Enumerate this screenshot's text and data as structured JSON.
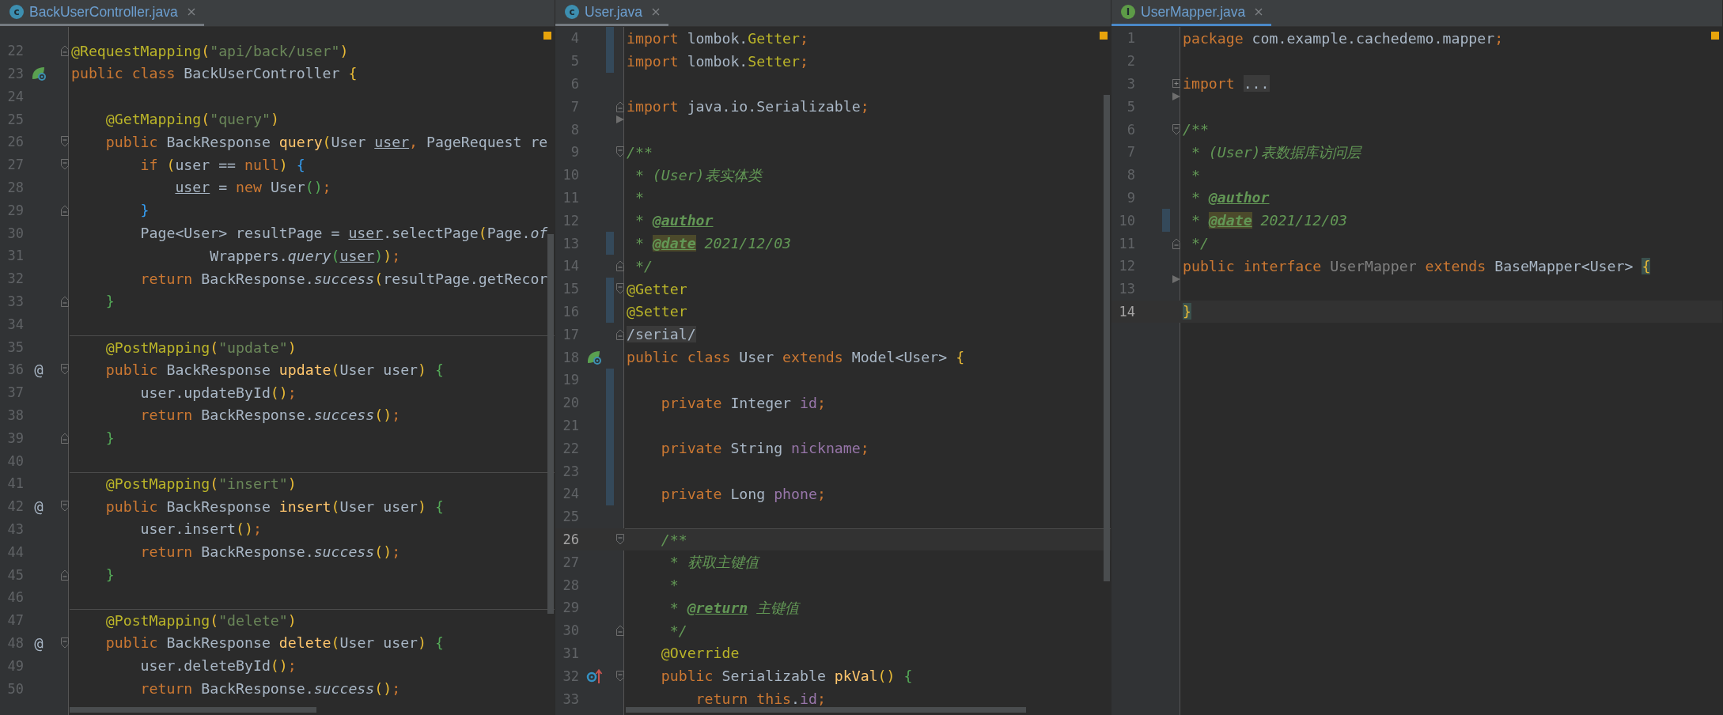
{
  "panes": [
    {
      "tab": {
        "icon": {
          "kind": "class",
          "letter": "c"
        },
        "label": "BackUserController.java",
        "selected": false
      },
      "lines": [
        {
          "number": "22",
          "current": false,
          "changed": false,
          "fold": {
            "kind": "close"
          },
          "tokens": [
            {
              "kind": "annotation",
              "text": "@RequestMapping"
            },
            {
              "kind": "paren_y",
              "text": "("
            },
            {
              "kind": "string",
              "text": "\"api/back/user\""
            },
            {
              "kind": "paren_y",
              "text": ")"
            }
          ]
        },
        {
          "number": "23",
          "current": false,
          "changed": false,
          "gutter_icon": {
            "kind": "bean"
          },
          "tokens": [
            {
              "kind": "keyword",
              "text": "public class "
            },
            {
              "kind": "plain",
              "text": "BackUserController "
            },
            {
              "kind": "paren_y",
              "text": "{"
            }
          ]
        },
        {
          "number": "24",
          "current": false,
          "changed": false
        },
        {
          "number": "25",
          "current": false,
          "changed": false,
          "tokens": [
            {
              "kind": "annotation",
              "text": "    @GetMapping"
            },
            {
              "kind": "paren_y",
              "text": "("
            },
            {
              "kind": "string",
              "text": "\"query\""
            },
            {
              "kind": "paren_y",
              "text": ")"
            }
          ]
        },
        {
          "number": "26",
          "current": false,
          "changed": false,
          "fold": {
            "kind": "open"
          },
          "tokens": [
            {
              "kind": "keyword",
              "text": "    public "
            },
            {
              "kind": "plain",
              "text": "BackResponse "
            },
            {
              "kind": "declaration",
              "text": "query"
            },
            {
              "kind": "paren_y",
              "text": "("
            },
            {
              "kind": "plain",
              "text": "User "
            },
            {
              "kind": "ref",
              "text": "user"
            },
            {
              "kind": "keyword",
              "text": ", "
            },
            {
              "kind": "plain",
              "text": "PageRequest re"
            }
          ]
        },
        {
          "number": "27",
          "current": false,
          "changed": false,
          "fold": {
            "kind": "open"
          },
          "tokens": [
            {
              "kind": "keyword",
              "text": "        if "
            },
            {
              "kind": "paren_y",
              "text": "("
            },
            {
              "kind": "plain",
              "text": "user == "
            },
            {
              "kind": "keyword",
              "text": "null"
            },
            {
              "kind": "paren_y",
              "text": ")"
            },
            {
              "kind": "paren_b",
              "text": " {"
            }
          ]
        },
        {
          "number": "28",
          "current": false,
          "changed": false,
          "tokens": [
            {
              "kind": "ref",
              "text": "            user"
            },
            {
              "kind": "plain",
              "text": " = "
            },
            {
              "kind": "keyword",
              "text": "new "
            },
            {
              "kind": "plain",
              "text": "User"
            },
            {
              "kind": "paren_g",
              "text": "()"
            },
            {
              "kind": "keyword",
              "text": ";"
            }
          ]
        },
        {
          "number": "29",
          "current": false,
          "changed": false,
          "fold": {
            "kind": "close"
          },
          "tokens": [
            {
              "kind": "paren_b",
              "text": "        }"
            }
          ]
        },
        {
          "number": "30",
          "current": false,
          "changed": false,
          "tokens": [
            {
              "kind": "plain",
              "text": "        Page<User> resultPage = "
            },
            {
              "kind": "ref",
              "text": "user"
            },
            {
              "kind": "plain",
              "text": ".selectPage"
            },
            {
              "kind": "paren_y",
              "text": "("
            },
            {
              "kind": "plain",
              "text": "Page."
            },
            {
              "kind": "static",
              "text": "of"
            }
          ]
        },
        {
          "number": "31",
          "current": false,
          "changed": false,
          "tokens": [
            {
              "kind": "plain",
              "text": "                Wrappers."
            },
            {
              "kind": "static",
              "text": "query"
            },
            {
              "kind": "paren_g",
              "text": "("
            },
            {
              "kind": "ref",
              "text": "user"
            },
            {
              "kind": "paren_g",
              "text": ")"
            },
            {
              "kind": "paren_y",
              "text": ")"
            },
            {
              "kind": "keyword",
              "text": ";"
            }
          ]
        },
        {
          "number": "32",
          "current": false,
          "changed": false,
          "tokens": [
            {
              "kind": "keyword",
              "text": "        return "
            },
            {
              "kind": "plain",
              "text": "BackResponse."
            },
            {
              "kind": "static",
              "text": "success"
            },
            {
              "kind": "paren_y",
              "text": "("
            },
            {
              "kind": "plain",
              "text": "resultPage.getRecor"
            }
          ]
        },
        {
          "number": "33",
          "current": false,
          "changed": false,
          "fold": {
            "kind": "close"
          },
          "tokens": [
            {
              "kind": "paren_g",
              "text": "    }"
            }
          ]
        },
        {
          "number": "34",
          "current": false,
          "changed": false
        },
        {
          "number": "35",
          "current": false,
          "changed": false,
          "separator": true,
          "tokens": [
            {
              "kind": "annotation",
              "text": "    @PostMapping"
            },
            {
              "kind": "paren_y",
              "text": "("
            },
            {
              "kind": "string",
              "text": "\"update\""
            },
            {
              "kind": "paren_y",
              "text": ")"
            }
          ]
        },
        {
          "number": "36",
          "current": false,
          "changed": false,
          "marker": "@",
          "fold": {
            "kind": "open"
          },
          "tokens": [
            {
              "kind": "keyword",
              "text": "    public "
            },
            {
              "kind": "plain",
              "text": "BackResponse "
            },
            {
              "kind": "declaration",
              "text": "update"
            },
            {
              "kind": "paren_y",
              "text": "("
            },
            {
              "kind": "plain",
              "text": "User user"
            },
            {
              "kind": "paren_y",
              "text": ")"
            },
            {
              "kind": "paren_g",
              "text": " {"
            }
          ]
        },
        {
          "number": "37",
          "current": false,
          "changed": false,
          "tokens": [
            {
              "kind": "plain",
              "text": "        user.updateById"
            },
            {
              "kind": "paren_y",
              "text": "()"
            },
            {
              "kind": "keyword",
              "text": ";"
            }
          ]
        },
        {
          "number": "38",
          "current": false,
          "changed": false,
          "tokens": [
            {
              "kind": "keyword",
              "text": "        return "
            },
            {
              "kind": "plain",
              "text": "BackResponse."
            },
            {
              "kind": "static",
              "text": "success"
            },
            {
              "kind": "paren_y",
              "text": "()"
            },
            {
              "kind": "keyword",
              "text": ";"
            }
          ]
        },
        {
          "number": "39",
          "current": false,
          "changed": false,
          "fold": {
            "kind": "close"
          },
          "tokens": [
            {
              "kind": "paren_g",
              "text": "    }"
            }
          ]
        },
        {
          "number": "40",
          "current": false,
          "changed": false
        },
        {
          "number": "41",
          "current": false,
          "changed": false,
          "separator": true,
          "tokens": [
            {
              "kind": "annotation",
              "text": "    @PostMapping"
            },
            {
              "kind": "paren_y",
              "text": "("
            },
            {
              "kind": "string",
              "text": "\"insert\""
            },
            {
              "kind": "paren_y",
              "text": ")"
            }
          ]
        },
        {
          "number": "42",
          "current": false,
          "changed": false,
          "marker": "@",
          "fold": {
            "kind": "open"
          },
          "tokens": [
            {
              "kind": "keyword",
              "text": "    public "
            },
            {
              "kind": "plain",
              "text": "BackResponse "
            },
            {
              "kind": "declaration",
              "text": "insert"
            },
            {
              "kind": "paren_y",
              "text": "("
            },
            {
              "kind": "plain",
              "text": "User user"
            },
            {
              "kind": "paren_y",
              "text": ")"
            },
            {
              "kind": "paren_g",
              "text": " {"
            }
          ]
        },
        {
          "number": "43",
          "current": false,
          "changed": false,
          "tokens": [
            {
              "kind": "plain",
              "text": "        user.insert"
            },
            {
              "kind": "paren_y",
              "text": "()"
            },
            {
              "kind": "keyword",
              "text": ";"
            }
          ]
        },
        {
          "number": "44",
          "current": false,
          "changed": false,
          "tokens": [
            {
              "kind": "keyword",
              "text": "        return "
            },
            {
              "kind": "plain",
              "text": "BackResponse."
            },
            {
              "kind": "static",
              "text": "success"
            },
            {
              "kind": "paren_y",
              "text": "()"
            },
            {
              "kind": "keyword",
              "text": ";"
            }
          ]
        },
        {
          "number": "45",
          "current": false,
          "changed": false,
          "fold": {
            "kind": "close"
          },
          "tokens": [
            {
              "kind": "paren_g",
              "text": "    }"
            }
          ]
        },
        {
          "number": "46",
          "current": false,
          "changed": false
        },
        {
          "number": "47",
          "current": false,
          "changed": false,
          "separator": true,
          "tokens": [
            {
              "kind": "annotation",
              "text": "    @PostMapping"
            },
            {
              "kind": "paren_y",
              "text": "("
            },
            {
              "kind": "string",
              "text": "\"delete\""
            },
            {
              "kind": "paren_y",
              "text": ")"
            }
          ]
        },
        {
          "number": "48",
          "current": false,
          "changed": false,
          "marker": "@",
          "fold": {
            "kind": "open"
          },
          "tokens": [
            {
              "kind": "keyword",
              "text": "    public "
            },
            {
              "kind": "plain",
              "text": "BackResponse "
            },
            {
              "kind": "declaration",
              "text": "delete"
            },
            {
              "kind": "paren_y",
              "text": "("
            },
            {
              "kind": "plain",
              "text": "User user"
            },
            {
              "kind": "paren_y",
              "text": ")"
            },
            {
              "kind": "paren_g",
              "text": " {"
            }
          ]
        },
        {
          "number": "49",
          "current": false,
          "changed": false,
          "tokens": [
            {
              "kind": "plain",
              "text": "        user.deleteById"
            },
            {
              "kind": "paren_y",
              "text": "()"
            },
            {
              "kind": "keyword",
              "text": ";"
            }
          ]
        },
        {
          "number": "50",
          "current": false,
          "changed": false,
          "tokens": [
            {
              "kind": "keyword",
              "text": "        return "
            },
            {
              "kind": "plain",
              "text": "BackResponse."
            },
            {
              "kind": "static",
              "text": "success"
            },
            {
              "kind": "paren_y",
              "text": "()"
            },
            {
              "kind": "keyword",
              "text": ";"
            }
          ]
        }
      ]
    },
    {
      "tab": {
        "icon": {
          "kind": "class",
          "letter": "c"
        },
        "label": "User.java",
        "selected": false
      },
      "lines": [
        {
          "number": "4",
          "current": false,
          "changed": true,
          "tokens": [
            {
              "kind": "keyword",
              "text": "import "
            },
            {
              "kind": "plain",
              "text": "lombok."
            },
            {
              "kind": "annotation",
              "text": "Getter"
            },
            {
              "kind": "keyword",
              "text": ";"
            }
          ]
        },
        {
          "number": "5",
          "current": false,
          "changed": true,
          "tokens": [
            {
              "kind": "keyword",
              "text": "import "
            },
            {
              "kind": "plain",
              "text": "lombok."
            },
            {
              "kind": "annotation",
              "text": "Setter"
            },
            {
              "kind": "keyword",
              "text": ";"
            }
          ]
        },
        {
          "number": "6",
          "current": false,
          "changed": false
        },
        {
          "number": "7",
          "current": false,
          "changed": false,
          "fold": {
            "kind": "close"
          },
          "tokens": [
            {
              "kind": "keyword",
              "text": "import "
            },
            {
              "kind": "plain",
              "text": "java.io.Serializable"
            },
            {
              "kind": "keyword",
              "text": ";"
            }
          ]
        },
        {
          "number": "8",
          "current": false,
          "changed": false,
          "fold": {
            "kind": "arrow"
          }
        },
        {
          "number": "9",
          "current": false,
          "changed": false,
          "fold": {
            "kind": "open"
          },
          "tokens": [
            {
              "kind": "doc",
              "text": "/**"
            }
          ]
        },
        {
          "number": "10",
          "current": false,
          "changed": false,
          "tokens": [
            {
              "kind": "doc",
              "text": " * (User)表实体类"
            }
          ]
        },
        {
          "number": "11",
          "current": false,
          "changed": false,
          "tokens": [
            {
              "kind": "doc",
              "text": " *"
            }
          ]
        },
        {
          "number": "12",
          "current": false,
          "changed": false,
          "tokens": [
            {
              "kind": "doc",
              "text": " * "
            },
            {
              "kind": "doctag",
              "text": "@author"
            }
          ]
        },
        {
          "number": "13",
          "current": false,
          "changed": true,
          "tokens": [
            {
              "kind": "doc",
              "text": " * "
            },
            {
              "kind": "doctag_box",
              "text": "@date"
            },
            {
              "kind": "doc",
              "text": " 2021/12/03"
            }
          ]
        },
        {
          "number": "14",
          "current": false,
          "changed": false,
          "fold": {
            "kind": "close"
          },
          "tokens": [
            {
              "kind": "doc",
              "text": " */"
            }
          ]
        },
        {
          "number": "15",
          "current": false,
          "changed": true,
          "fold": {
            "kind": "open"
          },
          "tokens": [
            {
              "kind": "annotation",
              "text": "@Getter"
            }
          ]
        },
        {
          "number": "16",
          "current": false,
          "changed": true,
          "tokens": [
            {
              "kind": "annotation",
              "text": "@Setter"
            }
          ]
        },
        {
          "number": "17",
          "current": false,
          "changed": false,
          "fold": {
            "kind": "close"
          },
          "tokens": [
            {
              "kind": "folded",
              "text": "/serial/"
            }
          ]
        },
        {
          "number": "18",
          "current": false,
          "changed": false,
          "gutter_icon": {
            "kind": "bean"
          },
          "tokens": [
            {
              "kind": "keyword",
              "text": "public class "
            },
            {
              "kind": "plain",
              "text": "User "
            },
            {
              "kind": "keyword",
              "text": "extends "
            },
            {
              "kind": "plain",
              "text": "Model<User> "
            },
            {
              "kind": "paren_y",
              "text": "{"
            }
          ]
        },
        {
          "number": "19",
          "current": false,
          "changed": true
        },
        {
          "number": "20",
          "current": false,
          "changed": true,
          "tokens": [
            {
              "kind": "keyword",
              "text": "    private "
            },
            {
              "kind": "plain",
              "text": "Integer "
            },
            {
              "kind": "field",
              "text": "id"
            },
            {
              "kind": "keyword",
              "text": ";"
            }
          ]
        },
        {
          "number": "21",
          "current": false,
          "changed": true
        },
        {
          "number": "22",
          "current": false,
          "changed": true,
          "tokens": [
            {
              "kind": "keyword",
              "text": "    private "
            },
            {
              "kind": "plain",
              "text": "String "
            },
            {
              "kind": "field",
              "text": "nickname"
            },
            {
              "kind": "keyword",
              "text": ";"
            }
          ]
        },
        {
          "number": "23",
          "current": false,
          "changed": true
        },
        {
          "number": "24",
          "current": false,
          "changed": true,
          "tokens": [
            {
              "kind": "keyword",
              "text": "    private "
            },
            {
              "kind": "plain",
              "text": "Long "
            },
            {
              "kind": "field",
              "text": "phone"
            },
            {
              "kind": "keyword",
              "text": ";"
            }
          ]
        },
        {
          "number": "25",
          "current": false,
          "changed": false
        },
        {
          "number": "26",
          "current": true,
          "changed": false,
          "separator": true,
          "fold": {
            "kind": "open"
          },
          "tokens": [
            {
              "kind": "doc",
              "text": "    /**"
            }
          ]
        },
        {
          "number": "27",
          "current": false,
          "changed": false,
          "tokens": [
            {
              "kind": "doc",
              "text": "     * 获取主键值"
            }
          ]
        },
        {
          "number": "28",
          "current": false,
          "changed": false,
          "tokens": [
            {
              "kind": "doc",
              "text": "     *"
            }
          ]
        },
        {
          "number": "29",
          "current": false,
          "changed": false,
          "tokens": [
            {
              "kind": "doc",
              "text": "     * "
            },
            {
              "kind": "doctag",
              "text": "@return"
            },
            {
              "kind": "doc",
              "text": " 主键值"
            }
          ]
        },
        {
          "number": "30",
          "current": false,
          "changed": false,
          "fold": {
            "kind": "close"
          },
          "tokens": [
            {
              "kind": "doc",
              "text": "     */"
            }
          ]
        },
        {
          "number": "31",
          "current": false,
          "changed": false,
          "tokens": [
            {
              "kind": "annotation",
              "text": "    @Override"
            }
          ]
        },
        {
          "number": "32",
          "current": false,
          "changed": false,
          "gutter_icon": {
            "kind": "override"
          },
          "fold": {
            "kind": "open"
          },
          "tokens": [
            {
              "kind": "keyword",
              "text": "    public "
            },
            {
              "kind": "plain",
              "text": "Serializable "
            },
            {
              "kind": "declaration",
              "text": "pkVal"
            },
            {
              "kind": "paren_y",
              "text": "()"
            },
            {
              "kind": "paren_g",
              "text": " {"
            }
          ]
        },
        {
          "number": "33",
          "current": false,
          "changed": false,
          "tokens": [
            {
              "kind": "keyword",
              "text": "        return this"
            },
            {
              "kind": "plain",
              "text": "."
            },
            {
              "kind": "field",
              "text": "id"
            },
            {
              "kind": "keyword",
              "text": ";"
            }
          ]
        }
      ]
    },
    {
      "tab": {
        "icon": {
          "kind": "interface",
          "letter": "I"
        },
        "label": "UserMapper.java",
        "selected": true
      },
      "lines": [
        {
          "number": "1",
          "current": false,
          "changed": false,
          "tokens": [
            {
              "kind": "keyword",
              "text": "package "
            },
            {
              "kind": "plain",
              "text": "com.example.cachedemo.mapper"
            },
            {
              "kind": "keyword",
              "text": ";"
            }
          ]
        },
        {
          "number": "2",
          "current": false,
          "changed": false
        },
        {
          "number": "3",
          "current": false,
          "changed": false,
          "fold": {
            "kind": "plus"
          },
          "tokens": [
            {
              "kind": "keyword",
              "text": "import "
            },
            {
              "kind": "folded",
              "text": "..."
            }
          ]
        },
        {
          "number": "5",
          "current": false,
          "changed": false,
          "fold": {
            "kind": "arrow"
          }
        },
        {
          "number": "6",
          "current": false,
          "changed": false,
          "fold": {
            "kind": "open"
          },
          "tokens": [
            {
              "kind": "doc",
              "text": "/**"
            }
          ]
        },
        {
          "number": "7",
          "current": false,
          "changed": false,
          "tokens": [
            {
              "kind": "doc",
              "text": " * (User)表数据库访问层"
            }
          ]
        },
        {
          "number": "8",
          "current": false,
          "changed": false,
          "tokens": [
            {
              "kind": "doc",
              "text": " *"
            }
          ]
        },
        {
          "number": "9",
          "current": false,
          "changed": false,
          "tokens": [
            {
              "kind": "doc",
              "text": " * "
            },
            {
              "kind": "doctag",
              "text": "@author"
            }
          ]
        },
        {
          "number": "10",
          "current": false,
          "changed": true,
          "tokens": [
            {
              "kind": "doc",
              "text": " * "
            },
            {
              "kind": "doctag_box",
              "text": "@date"
            },
            {
              "kind": "doc",
              "text": " 2021/12/03"
            }
          ]
        },
        {
          "number": "11",
          "current": false,
          "changed": false,
          "fold": {
            "kind": "close"
          },
          "tokens": [
            {
              "kind": "doc",
              "text": " */"
            }
          ]
        },
        {
          "number": "12",
          "current": false,
          "changed": false,
          "tokens": [
            {
              "kind": "keyword",
              "text": "public interface "
            },
            {
              "kind": "unused",
              "text": "UserMapper "
            },
            {
              "kind": "keyword",
              "text": "extends "
            },
            {
              "kind": "plain",
              "text": "BaseMapper<User> "
            },
            {
              "kind": "brace_match",
              "text": "{"
            }
          ]
        },
        {
          "number": "13",
          "current": false,
          "changed": false,
          "fold": {
            "kind": "arrow"
          }
        },
        {
          "number": "14",
          "current": true,
          "changed": false,
          "tokens": [
            {
              "kind": "brace_match",
              "text": "}"
            }
          ]
        }
      ]
    }
  ]
}
